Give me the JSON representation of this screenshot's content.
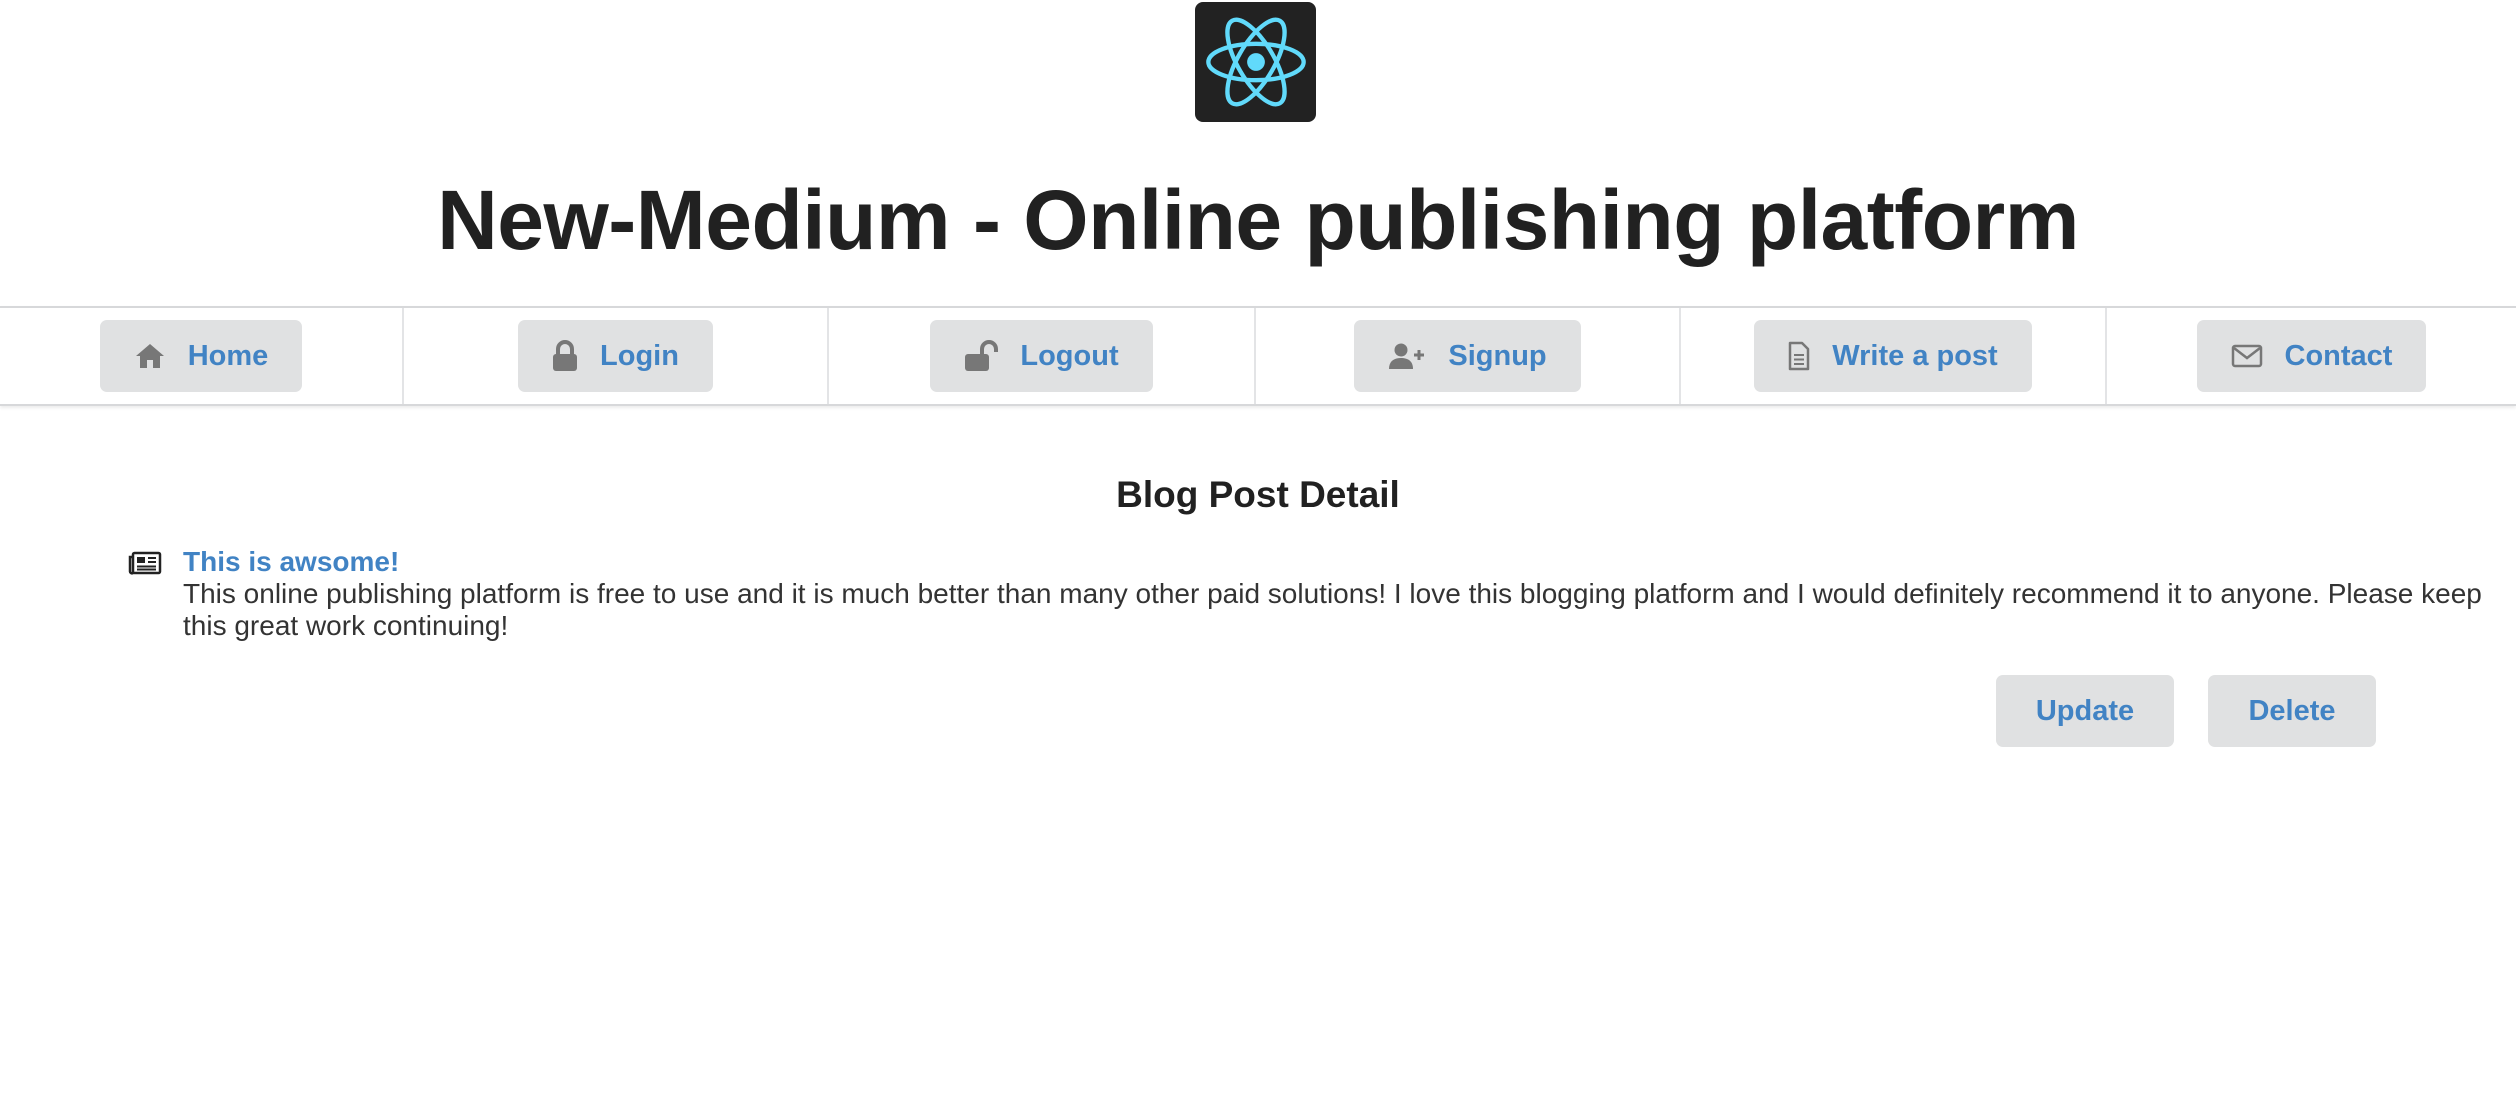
{
  "header": {
    "logo_icon": "react-logo-icon",
    "title": "New-Medium - Online publishing platform"
  },
  "nav": {
    "items": [
      {
        "label": "Home",
        "icon": "home-icon"
      },
      {
        "label": "Login",
        "icon": "lock-icon"
      },
      {
        "label": "Logout",
        "icon": "unlock-icon"
      },
      {
        "label": "Signup",
        "icon": "user-plus-icon"
      },
      {
        "label": "Write a post",
        "icon": "file-icon"
      },
      {
        "label": "Contact",
        "icon": "envelope-icon"
      }
    ]
  },
  "main": {
    "heading": "Blog Post Detail",
    "post": {
      "icon": "newspaper-icon",
      "title": "This is awsome!",
      "body": "This online publishing platform is free to use and it is much better than many other paid solutions! I love this blogging platform and I would definitely recommend it to anyone. Please keep this great work continuing!"
    },
    "actions": {
      "update_label": "Update",
      "delete_label": "Delete"
    }
  },
  "colors": {
    "link": "#4183c4",
    "button_bg": "#e0e1e2",
    "text": "#212121",
    "react_blue": "#61dafb"
  }
}
